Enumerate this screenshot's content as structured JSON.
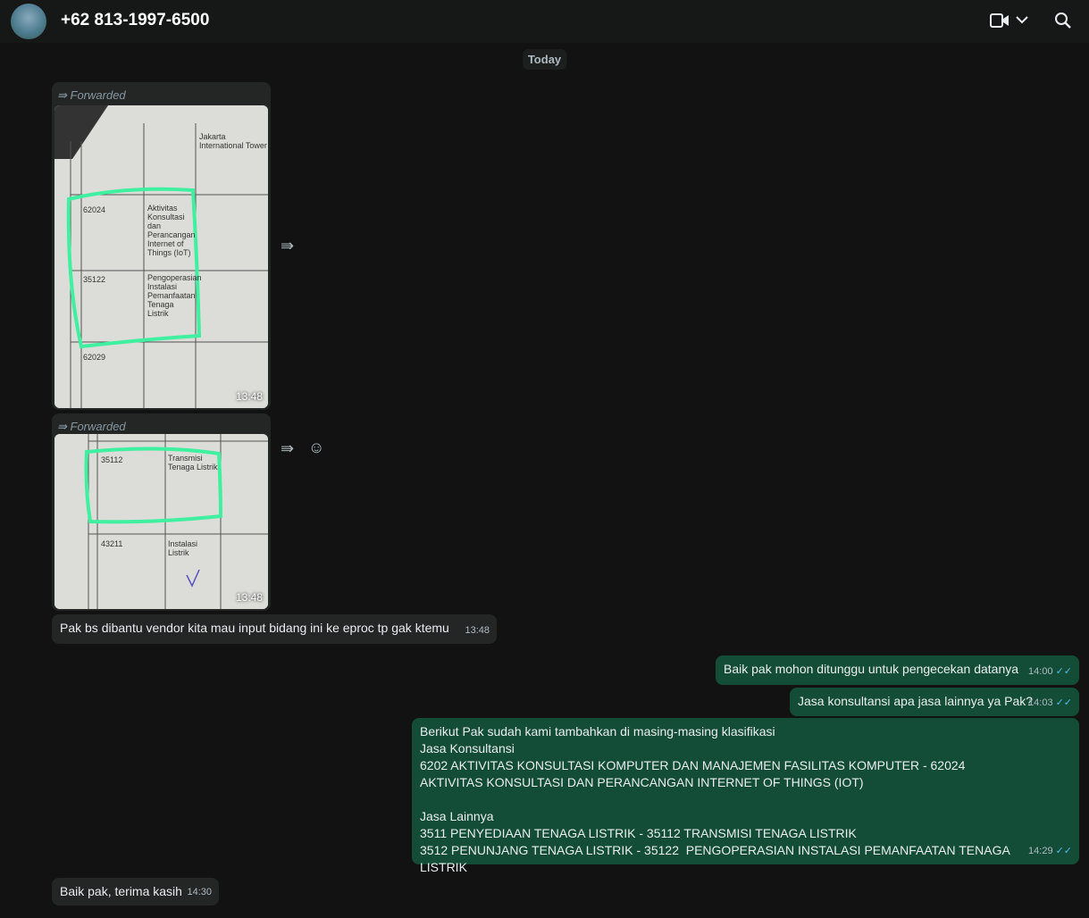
{
  "header": {
    "contact": "+62 813-1997-6500"
  },
  "date_divider": "Today",
  "messages": [
    {
      "forwarded": "Forwarded",
      "time": "13:48",
      "cells": [
        "62024",
        "Aktivitas Konsultasi dan Perancangan Internet of Things (IoT)",
        "35122",
        "Pengoperasian Instalasi Pemanfaatan Tenaga Listrik",
        "62029",
        "Jakarta International Tower"
      ]
    },
    {
      "forwarded": "Forwarded",
      "time": "13:48",
      "cells": [
        "35112",
        "Transmisi Tenaga Listrik",
        "43211",
        "Instalasi Listrik"
      ]
    },
    {
      "text": "Pak bs dibantu vendor kita mau input bidang ini ke eproc tp gak ktemu",
      "time": "13:48"
    },
    {
      "text": "Baik pak mohon ditunggu untuk pengecekan datanya",
      "time": "14:00"
    },
    {
      "text": "Jasa konsultansi apa jasa lainnya ya Pak?",
      "time": "14:03"
    },
    {
      "text": "Berikut Pak sudah kami tambahkan di masing-masing klasifikasi\nJasa Konsultansi\n6202 AKTIVITAS KONSULTASI KOMPUTER DAN MANAJEMEN FASILITAS KOMPUTER - 62024 AKTIVITAS KONSULTASI DAN PERANCANGAN INTERNET OF THINGS (IOT)\n\nJasa Lainnya\n3511 PENYEDIAAN TENAGA LISTRIK - 35112 TRANSMISI TENAGA LISTRIK\n3512 PENUNJANG TENAGA LISTRIK - 35122  PENGOPERASIAN INSTALASI PEMANFAATAN TENAGA LISTRIK",
      "time": "14:29"
    },
    {
      "text": "Baik pak, terima kasih",
      "time": "14:30"
    }
  ],
  "colors": {
    "incoming": "#242626",
    "outgoing": "#144d37",
    "read_tick": "#53bdeb",
    "highlight": "#3ef0a0"
  }
}
